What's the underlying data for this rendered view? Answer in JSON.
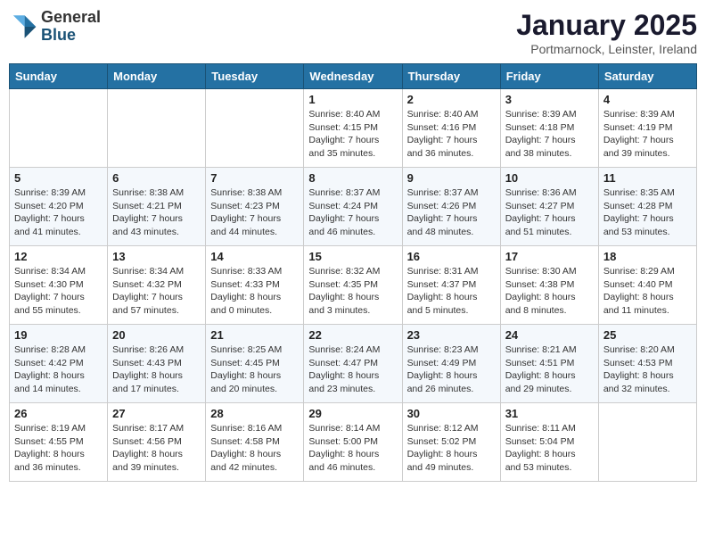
{
  "header": {
    "logo_general": "General",
    "logo_blue": "Blue",
    "month_title": "January 2025",
    "subtitle": "Portmarnock, Leinster, Ireland"
  },
  "days_of_week": [
    "Sunday",
    "Monday",
    "Tuesday",
    "Wednesday",
    "Thursday",
    "Friday",
    "Saturday"
  ],
  "weeks": [
    [
      {
        "day": "",
        "info": ""
      },
      {
        "day": "",
        "info": ""
      },
      {
        "day": "",
        "info": ""
      },
      {
        "day": "1",
        "info": "Sunrise: 8:40 AM\nSunset: 4:15 PM\nDaylight: 7 hours\nand 35 minutes."
      },
      {
        "day": "2",
        "info": "Sunrise: 8:40 AM\nSunset: 4:16 PM\nDaylight: 7 hours\nand 36 minutes."
      },
      {
        "day": "3",
        "info": "Sunrise: 8:39 AM\nSunset: 4:18 PM\nDaylight: 7 hours\nand 38 minutes."
      },
      {
        "day": "4",
        "info": "Sunrise: 8:39 AM\nSunset: 4:19 PM\nDaylight: 7 hours\nand 39 minutes."
      }
    ],
    [
      {
        "day": "5",
        "info": "Sunrise: 8:39 AM\nSunset: 4:20 PM\nDaylight: 7 hours\nand 41 minutes."
      },
      {
        "day": "6",
        "info": "Sunrise: 8:38 AM\nSunset: 4:21 PM\nDaylight: 7 hours\nand 43 minutes."
      },
      {
        "day": "7",
        "info": "Sunrise: 8:38 AM\nSunset: 4:23 PM\nDaylight: 7 hours\nand 44 minutes."
      },
      {
        "day": "8",
        "info": "Sunrise: 8:37 AM\nSunset: 4:24 PM\nDaylight: 7 hours\nand 46 minutes."
      },
      {
        "day": "9",
        "info": "Sunrise: 8:37 AM\nSunset: 4:26 PM\nDaylight: 7 hours\nand 48 minutes."
      },
      {
        "day": "10",
        "info": "Sunrise: 8:36 AM\nSunset: 4:27 PM\nDaylight: 7 hours\nand 51 minutes."
      },
      {
        "day": "11",
        "info": "Sunrise: 8:35 AM\nSunset: 4:28 PM\nDaylight: 7 hours\nand 53 minutes."
      }
    ],
    [
      {
        "day": "12",
        "info": "Sunrise: 8:34 AM\nSunset: 4:30 PM\nDaylight: 7 hours\nand 55 minutes."
      },
      {
        "day": "13",
        "info": "Sunrise: 8:34 AM\nSunset: 4:32 PM\nDaylight: 7 hours\nand 57 minutes."
      },
      {
        "day": "14",
        "info": "Sunrise: 8:33 AM\nSunset: 4:33 PM\nDaylight: 8 hours\nand 0 minutes."
      },
      {
        "day": "15",
        "info": "Sunrise: 8:32 AM\nSunset: 4:35 PM\nDaylight: 8 hours\nand 3 minutes."
      },
      {
        "day": "16",
        "info": "Sunrise: 8:31 AM\nSunset: 4:37 PM\nDaylight: 8 hours\nand 5 minutes."
      },
      {
        "day": "17",
        "info": "Sunrise: 8:30 AM\nSunset: 4:38 PM\nDaylight: 8 hours\nand 8 minutes."
      },
      {
        "day": "18",
        "info": "Sunrise: 8:29 AM\nSunset: 4:40 PM\nDaylight: 8 hours\nand 11 minutes."
      }
    ],
    [
      {
        "day": "19",
        "info": "Sunrise: 8:28 AM\nSunset: 4:42 PM\nDaylight: 8 hours\nand 14 minutes."
      },
      {
        "day": "20",
        "info": "Sunrise: 8:26 AM\nSunset: 4:43 PM\nDaylight: 8 hours\nand 17 minutes."
      },
      {
        "day": "21",
        "info": "Sunrise: 8:25 AM\nSunset: 4:45 PM\nDaylight: 8 hours\nand 20 minutes."
      },
      {
        "day": "22",
        "info": "Sunrise: 8:24 AM\nSunset: 4:47 PM\nDaylight: 8 hours\nand 23 minutes."
      },
      {
        "day": "23",
        "info": "Sunrise: 8:23 AM\nSunset: 4:49 PM\nDaylight: 8 hours\nand 26 minutes."
      },
      {
        "day": "24",
        "info": "Sunrise: 8:21 AM\nSunset: 4:51 PM\nDaylight: 8 hours\nand 29 minutes."
      },
      {
        "day": "25",
        "info": "Sunrise: 8:20 AM\nSunset: 4:53 PM\nDaylight: 8 hours\nand 32 minutes."
      }
    ],
    [
      {
        "day": "26",
        "info": "Sunrise: 8:19 AM\nSunset: 4:55 PM\nDaylight: 8 hours\nand 36 minutes."
      },
      {
        "day": "27",
        "info": "Sunrise: 8:17 AM\nSunset: 4:56 PM\nDaylight: 8 hours\nand 39 minutes."
      },
      {
        "day": "28",
        "info": "Sunrise: 8:16 AM\nSunset: 4:58 PM\nDaylight: 8 hours\nand 42 minutes."
      },
      {
        "day": "29",
        "info": "Sunrise: 8:14 AM\nSunset: 5:00 PM\nDaylight: 8 hours\nand 46 minutes."
      },
      {
        "day": "30",
        "info": "Sunrise: 8:12 AM\nSunset: 5:02 PM\nDaylight: 8 hours\nand 49 minutes."
      },
      {
        "day": "31",
        "info": "Sunrise: 8:11 AM\nSunset: 5:04 PM\nDaylight: 8 hours\nand 53 minutes."
      },
      {
        "day": "",
        "info": ""
      }
    ]
  ]
}
